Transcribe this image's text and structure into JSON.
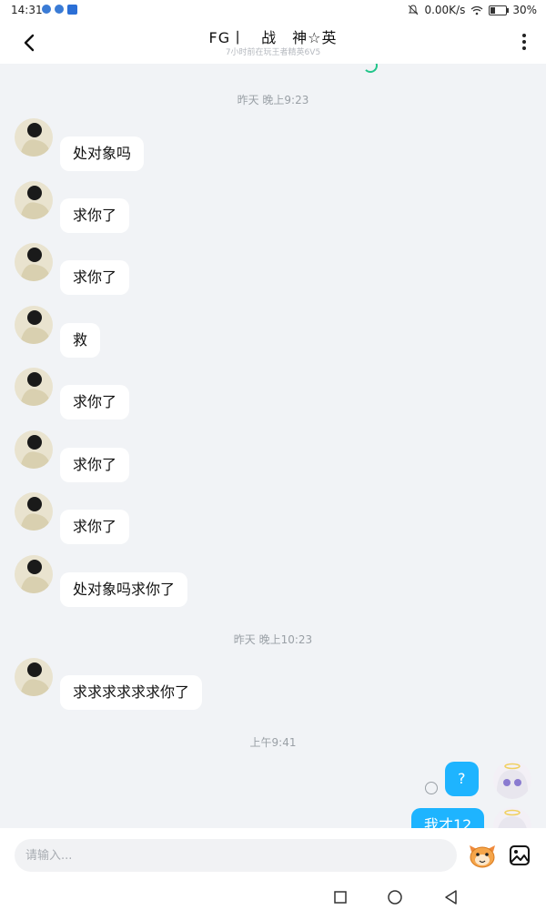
{
  "status_bar": {
    "time": "14:31",
    "network_speed": "0.00K/s",
    "battery": "30%",
    "battery_level": 0.3
  },
  "header": {
    "title": "FG丨　战　神☆英",
    "subtitle": "7小时前在玩王者精英6V5"
  },
  "timestamps": {
    "t1": "昨天 晚上9:23",
    "t2": "昨天 晚上10:23",
    "t3": "上午9:41"
  },
  "messages": [
    {
      "from": "other",
      "text": "处对象吗"
    },
    {
      "from": "other",
      "text": "求你了"
    },
    {
      "from": "other",
      "text": "求你了"
    },
    {
      "from": "other",
      "text": "救"
    },
    {
      "from": "other",
      "text": "求你了"
    },
    {
      "from": "other",
      "text": "求你了"
    },
    {
      "from": "other",
      "text": "求你了"
    },
    {
      "from": "other",
      "text": "处对象吗求你了"
    },
    {
      "from": "other",
      "text": "求求求求求求你了"
    },
    {
      "from": "me",
      "text": "?"
    },
    {
      "from": "me",
      "text": "我才12"
    }
  ],
  "input": {
    "placeholder": "请输入..."
  },
  "icons": {
    "back": "chevron-left-icon",
    "more": "more-vertical-icon",
    "emoji": "emoji-face-icon",
    "image": "image-icon",
    "nav_recent": "square-icon",
    "nav_home": "circle-icon",
    "nav_back": "triangle-back-icon"
  },
  "colors": {
    "chat_background": "#f1f3f6",
    "my_bubble": "#1eb4ff",
    "other_bubble": "#ffffff",
    "loading_accent": "#22c58a"
  }
}
